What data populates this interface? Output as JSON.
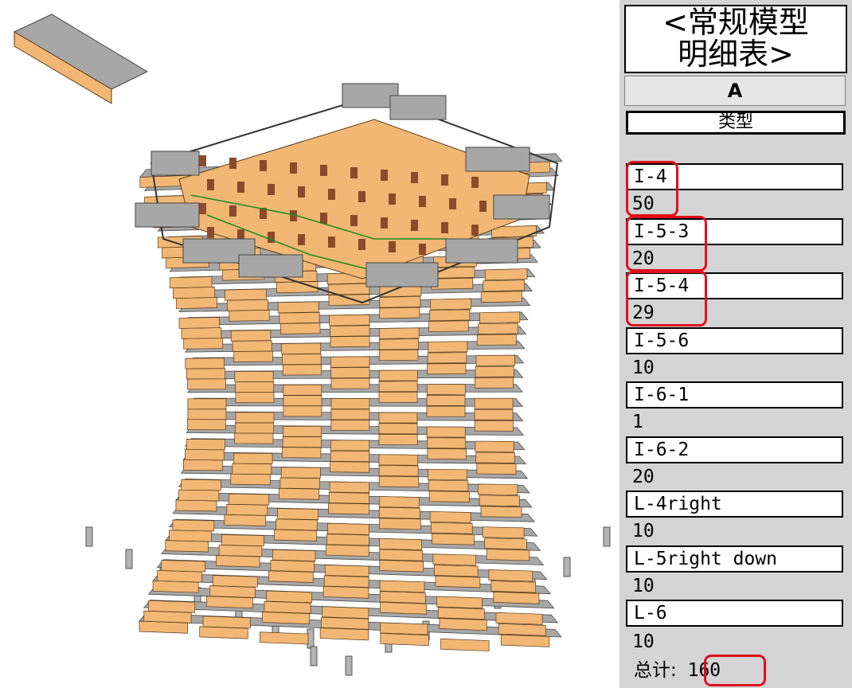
{
  "schedule": {
    "title_line1": "<常规模型",
    "title_line2": "明细表>",
    "column_header": "A",
    "column_name": "类型",
    "rows": [
      {
        "type": "I-4",
        "count": "50"
      },
      {
        "type": "I-5-3",
        "count": "20"
      },
      {
        "type": "I-5-4",
        "count": "29"
      },
      {
        "type": "I-5-6",
        "count": "10"
      },
      {
        "type": "I-6-1",
        "count": "1"
      },
      {
        "type": "I-6-2",
        "count": "20"
      },
      {
        "type": "L-4right",
        "count": "10"
      },
      {
        "type": "L-5right down",
        "count": "10"
      },
      {
        "type": "L-6",
        "count": "10"
      }
    ],
    "total_label": "总计:",
    "total_value": "160"
  },
  "colors": {
    "panel_orange": "#f2b774",
    "floor_gray": "#a7a7a7",
    "dark_brown": "#8b4a2b",
    "highlight_red": "#e0101a",
    "brace_green": "#1f8a1f"
  }
}
